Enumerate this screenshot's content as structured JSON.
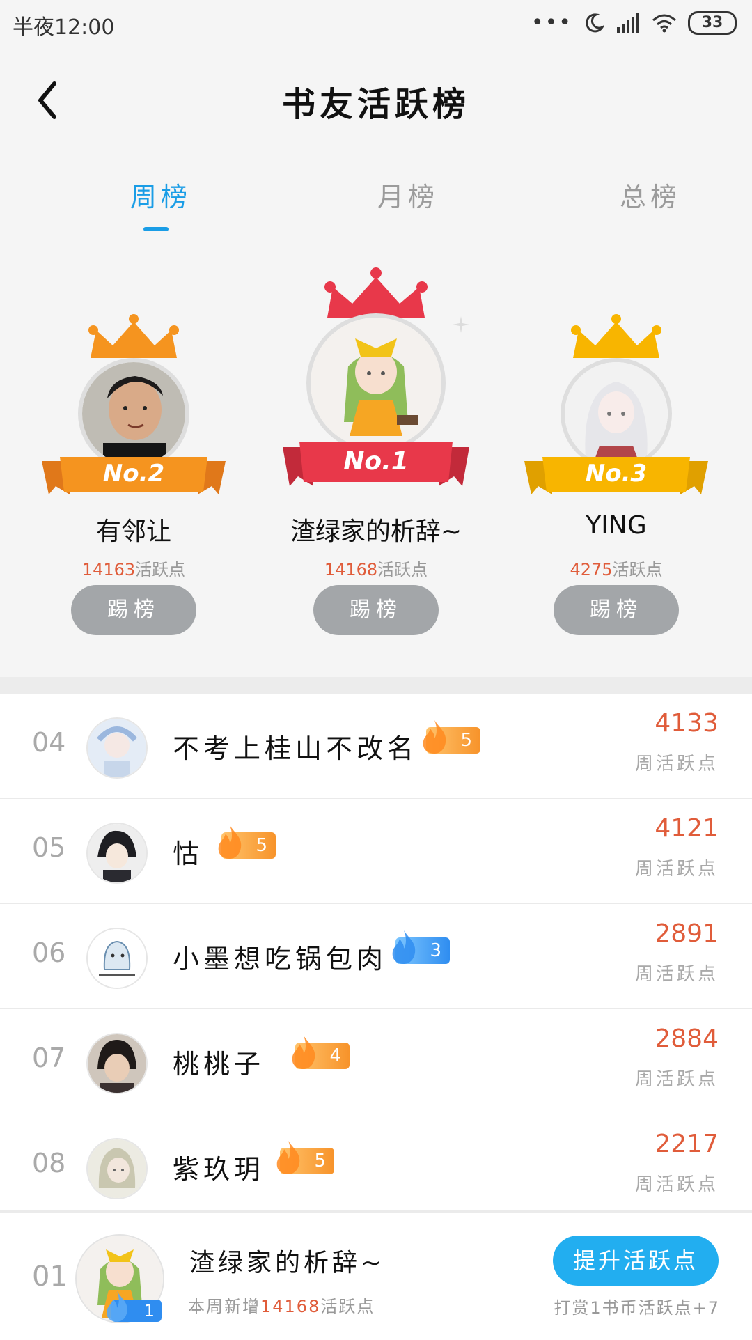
{
  "status_bar": {
    "time": "半夜12:00",
    "dots": "•••",
    "battery": "33"
  },
  "header": {
    "title": "书友活跃榜"
  },
  "tabs": [
    {
      "label": "周榜",
      "active": true
    },
    {
      "label": "月榜",
      "active": false
    },
    {
      "label": "总榜",
      "active": false
    }
  ],
  "podium": {
    "first": {
      "rank_label": "No.1",
      "name": "渣绿家的析辞~",
      "points": "14168",
      "points_unit": "活跃点",
      "kick_label": "踢榜"
    },
    "second": {
      "rank_label": "No.2",
      "name": "有邻让",
      "points": "14163",
      "points_unit": "活跃点",
      "kick_label": "踢榜"
    },
    "third": {
      "rank_label": "No.3",
      "name": "YING",
      "points": "4275",
      "points_unit": "活跃点",
      "kick_label": "踢榜"
    }
  },
  "list": [
    {
      "rank": "04",
      "name": "不考上桂山不改名",
      "level": "5",
      "badge_color": "orange",
      "score": "4133",
      "score_label": "周活跃点"
    },
    {
      "rank": "05",
      "name": "怙",
      "level": "5",
      "badge_color": "orange",
      "score": "4121",
      "score_label": "周活跃点"
    },
    {
      "rank": "06",
      "name": "小墨想吃锅包肉",
      "level": "3",
      "badge_color": "blue",
      "score": "2891",
      "score_label": "周活跃点"
    },
    {
      "rank": "07",
      "name": "桃桃子",
      "level": "4",
      "badge_color": "orange",
      "score": "2884",
      "score_label": "周活跃点"
    },
    {
      "rank": "08",
      "name": "紫玖玥",
      "level": "5",
      "badge_color": "orange",
      "score": "2217",
      "score_label": "周活跃点"
    }
  ],
  "my_bar": {
    "rank": "01",
    "name": "渣绿家的析辞~",
    "level": "1",
    "weekly_prefix": "本周新增",
    "weekly_points": "14168",
    "weekly_suffix": "活跃点",
    "boost_label": "提升活跃点",
    "hint": "打赏1书币活跃点+7"
  },
  "colors": {
    "accent": "#1a9de6",
    "points": "#e05c3a",
    "gold": "#f8b500",
    "red": "#e8384a",
    "orange": "#f5941f"
  }
}
